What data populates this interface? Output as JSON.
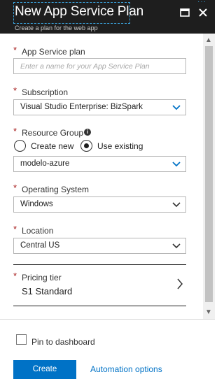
{
  "header": {
    "title": "New App Service Plan",
    "subtitle": "Create a plan for the web app"
  },
  "form": {
    "app_service_plan": {
      "label": "App Service plan",
      "placeholder": "Enter a name for your App Service Plan",
      "value": ""
    },
    "subscription": {
      "label": "Subscription",
      "value": "Visual Studio Enterprise: BizSpark"
    },
    "resource_group": {
      "label": "Resource Group",
      "options": [
        "Create new",
        "Use existing"
      ],
      "selected": "Use existing",
      "value": "modelo-azure"
    },
    "operating_system": {
      "label": "Operating System",
      "value": "Windows"
    },
    "location": {
      "label": "Location",
      "value": "Central US"
    },
    "pricing_tier": {
      "label": "Pricing tier",
      "value": "S1 Standard"
    },
    "required_marker": "*"
  },
  "footer": {
    "pin_label": "Pin to dashboard",
    "pin_checked": false,
    "create_label": "Create",
    "automation_label": "Automation options"
  },
  "colors": {
    "header_bg": "#1e1e1e",
    "accent": "#0072c6",
    "required": "#a51818"
  }
}
